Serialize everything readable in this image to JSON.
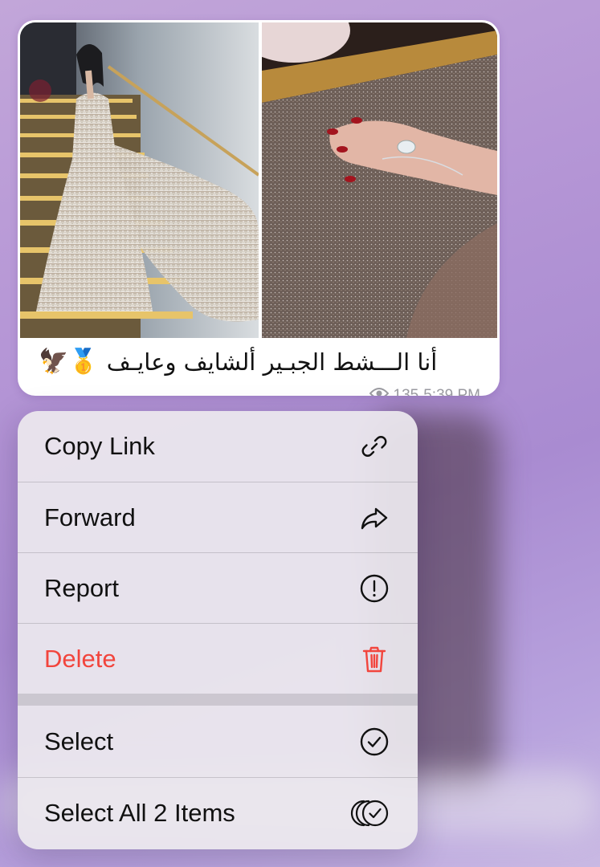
{
  "message": {
    "caption": "أنا الـــشط الجبـير ألشايف وعايـف",
    "caption_emoji": "🥇🦅",
    "views": "135",
    "time": "5:39 PM",
    "icons": {
      "views": "eye-icon"
    }
  },
  "menu": {
    "group1": [
      {
        "label": "Copy Link",
        "icon": "link-icon"
      },
      {
        "label": "Forward",
        "icon": "forward-arrow-icon"
      },
      {
        "label": "Report",
        "icon": "exclamation-circle-icon"
      },
      {
        "label": "Delete",
        "icon": "trash-icon",
        "color": "#f2453d"
      }
    ],
    "group2": [
      {
        "label": "Select",
        "icon": "check-circle-icon"
      },
      {
        "label": "Select All 2 Items",
        "icon": "multi-check-circle-icon"
      }
    ]
  },
  "colors": {
    "accent_danger": "#f2453d",
    "meta_text": "#9a9aa0",
    "background": "#b697d6"
  }
}
